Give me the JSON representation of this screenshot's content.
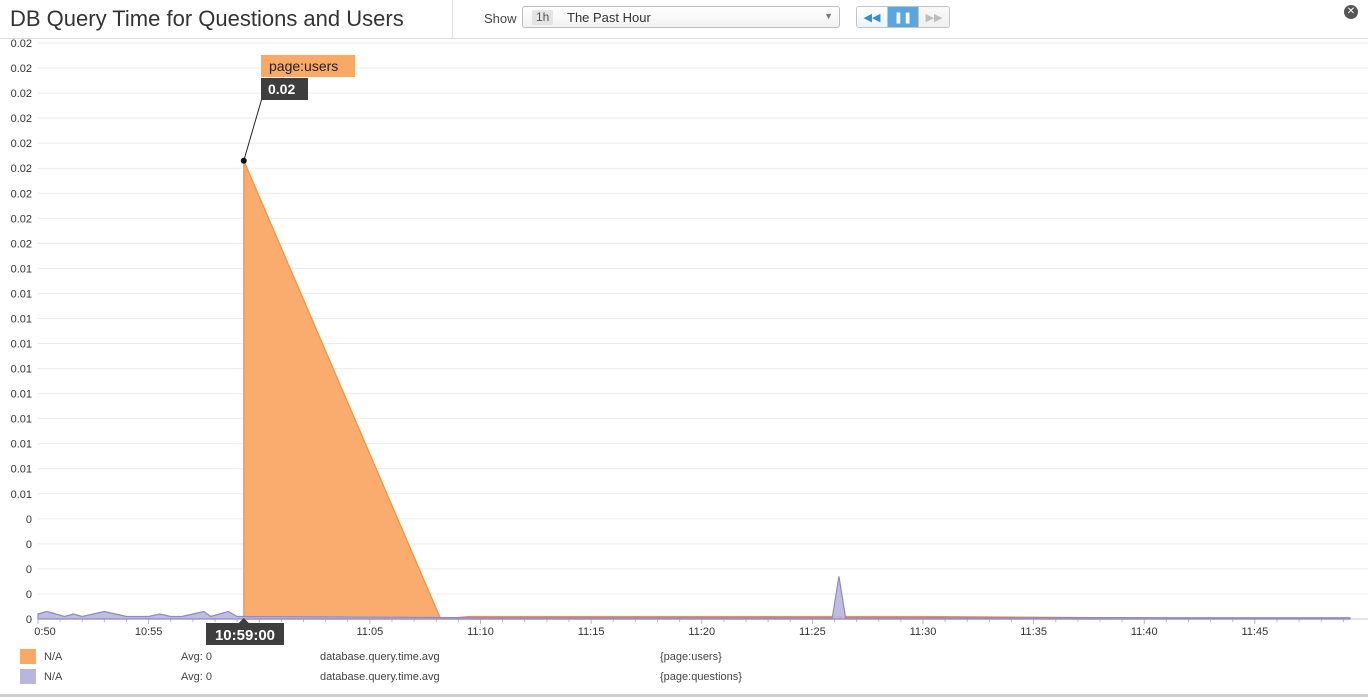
{
  "header": {
    "title": "DB Query Time for Questions and Users",
    "show_label": "Show",
    "timeframe_badge": "1h",
    "timeframe_label": "The Past Hour"
  },
  "playback": {
    "rewind_icon": "rewind-icon",
    "pause_icon": "pause-icon",
    "forward_icon": "fast-forward-icon"
  },
  "close_icon": "close-icon",
  "colors": {
    "users": "#f9a866",
    "users_line": "#f68e3c",
    "questions": "#b9b6dc",
    "questions_line": "#8e89c6"
  },
  "tooltip": {
    "series_tag": "page:users",
    "value": "0.02",
    "time": "10:59:00"
  },
  "chart_data": {
    "type": "area",
    "y_tick_labels": [
      "0.02",
      "0.02",
      "0.02",
      "0.02",
      "0.02",
      "0.02",
      "0.02",
      "0.02",
      "0.02",
      "0.01",
      "0.01",
      "0.01",
      "0.01",
      "0.01",
      "0.01",
      "0.01",
      "0.01",
      "0.01",
      "0.01",
      "0",
      "0",
      "0",
      "0",
      "0"
    ],
    "y_range": [
      0,
      0.023
    ],
    "x_tick_labels": [
      "0:50",
      "10:55",
      "11:05",
      "11:10",
      "11:15",
      "11:20",
      "11:25",
      "11:30",
      "11:35",
      "11:40",
      "11:45"
    ],
    "x_tick_minutes": [
      0,
      5,
      15,
      20,
      25,
      30,
      35,
      40,
      45,
      50,
      55
    ],
    "x_range_minutes": [
      0,
      59.3
    ],
    "grid": true,
    "series": [
      {
        "color": "#f9a866",
        "points": [
          [
            9.3,
            0
          ],
          [
            9.3,
            0.0183
          ],
          [
            18.2,
            0
          ],
          [
            19.5,
            0.0001
          ],
          [
            22,
            0.0001
          ],
          [
            32,
            0.0001
          ],
          [
            34.5,
            0.0001
          ],
          [
            38,
            0.0001
          ],
          [
            40,
            0.0001
          ],
          [
            59.3,
            0
          ]
        ]
      },
      {
        "color": "#b9b6dc",
        "points": [
          [
            0,
            0.0002
          ],
          [
            0.4,
            0.0003
          ],
          [
            0.8,
            0.0002
          ],
          [
            1.2,
            0.0001
          ],
          [
            1.6,
            0.0002
          ],
          [
            2,
            0.0001
          ],
          [
            2.5,
            0.0002
          ],
          [
            3,
            0.0003
          ],
          [
            3.5,
            0.0002
          ],
          [
            4,
            0.0001
          ],
          [
            5,
            0.0001
          ],
          [
            5.5,
            0.0002
          ],
          [
            6,
            0.0001
          ],
          [
            6.5,
            0.0001
          ],
          [
            7,
            0.0002
          ],
          [
            7.5,
            0.0003
          ],
          [
            7.8,
            0.0001
          ],
          [
            8.2,
            0.0002
          ],
          [
            8.6,
            0.0003
          ],
          [
            9,
            0.0001
          ],
          [
            9.3,
            0.0001
          ],
          [
            20,
            5e-05
          ],
          [
            30,
            5e-05
          ],
          [
            35.9,
            5e-05
          ],
          [
            36.2,
            0.0017
          ],
          [
            36.5,
            5e-05
          ],
          [
            40,
            5e-05
          ],
          [
            45,
            5e-05
          ],
          [
            50,
            5e-05
          ],
          [
            55,
            5e-05
          ],
          [
            59.3,
            5e-05
          ]
        ]
      }
    ]
  },
  "legend": [
    {
      "name": "N/A",
      "avg": "Avg: 0",
      "metric": "database.query.time.avg",
      "tag": "{page:users}",
      "color": "#f9a866"
    },
    {
      "name": "N/A",
      "avg": "Avg: 0",
      "metric": "database.query.time.avg",
      "tag": "{page:questions}",
      "color": "#b9b6dc"
    }
  ]
}
